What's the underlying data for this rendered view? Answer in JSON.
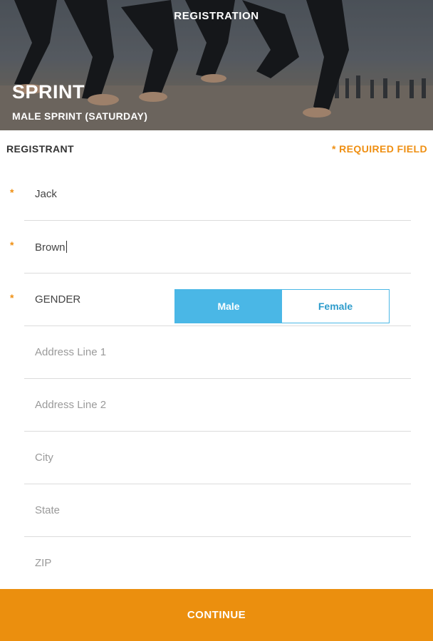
{
  "header": {
    "title": "REGISTRATION",
    "event_name": "SPRINT",
    "event_sub": "MALE SPRINT (SATURDAY)"
  },
  "section": {
    "label": "REGISTRANT",
    "required_note": "* REQUIRED FIELD"
  },
  "form": {
    "required_marker": "*",
    "first_name": {
      "value": "Jack",
      "required": true
    },
    "last_name": {
      "value": "Brown",
      "required": true
    },
    "gender": {
      "label": "GENDER",
      "options": [
        "Male",
        "Female"
      ],
      "selected": "Male",
      "required": true
    },
    "address1": {
      "placeholder": "Address Line 1",
      "value": ""
    },
    "address2": {
      "placeholder": "Address Line 2",
      "value": ""
    },
    "city": {
      "placeholder": "City",
      "value": ""
    },
    "state": {
      "placeholder": "State",
      "value": ""
    },
    "zip": {
      "placeholder": "ZIP",
      "value": ""
    }
  },
  "footer": {
    "continue_label": "CONTINUE"
  },
  "colors": {
    "accent_orange": "#eb8f0e",
    "accent_blue": "#4ab7e6",
    "hero_overlay": "#5f6770"
  }
}
